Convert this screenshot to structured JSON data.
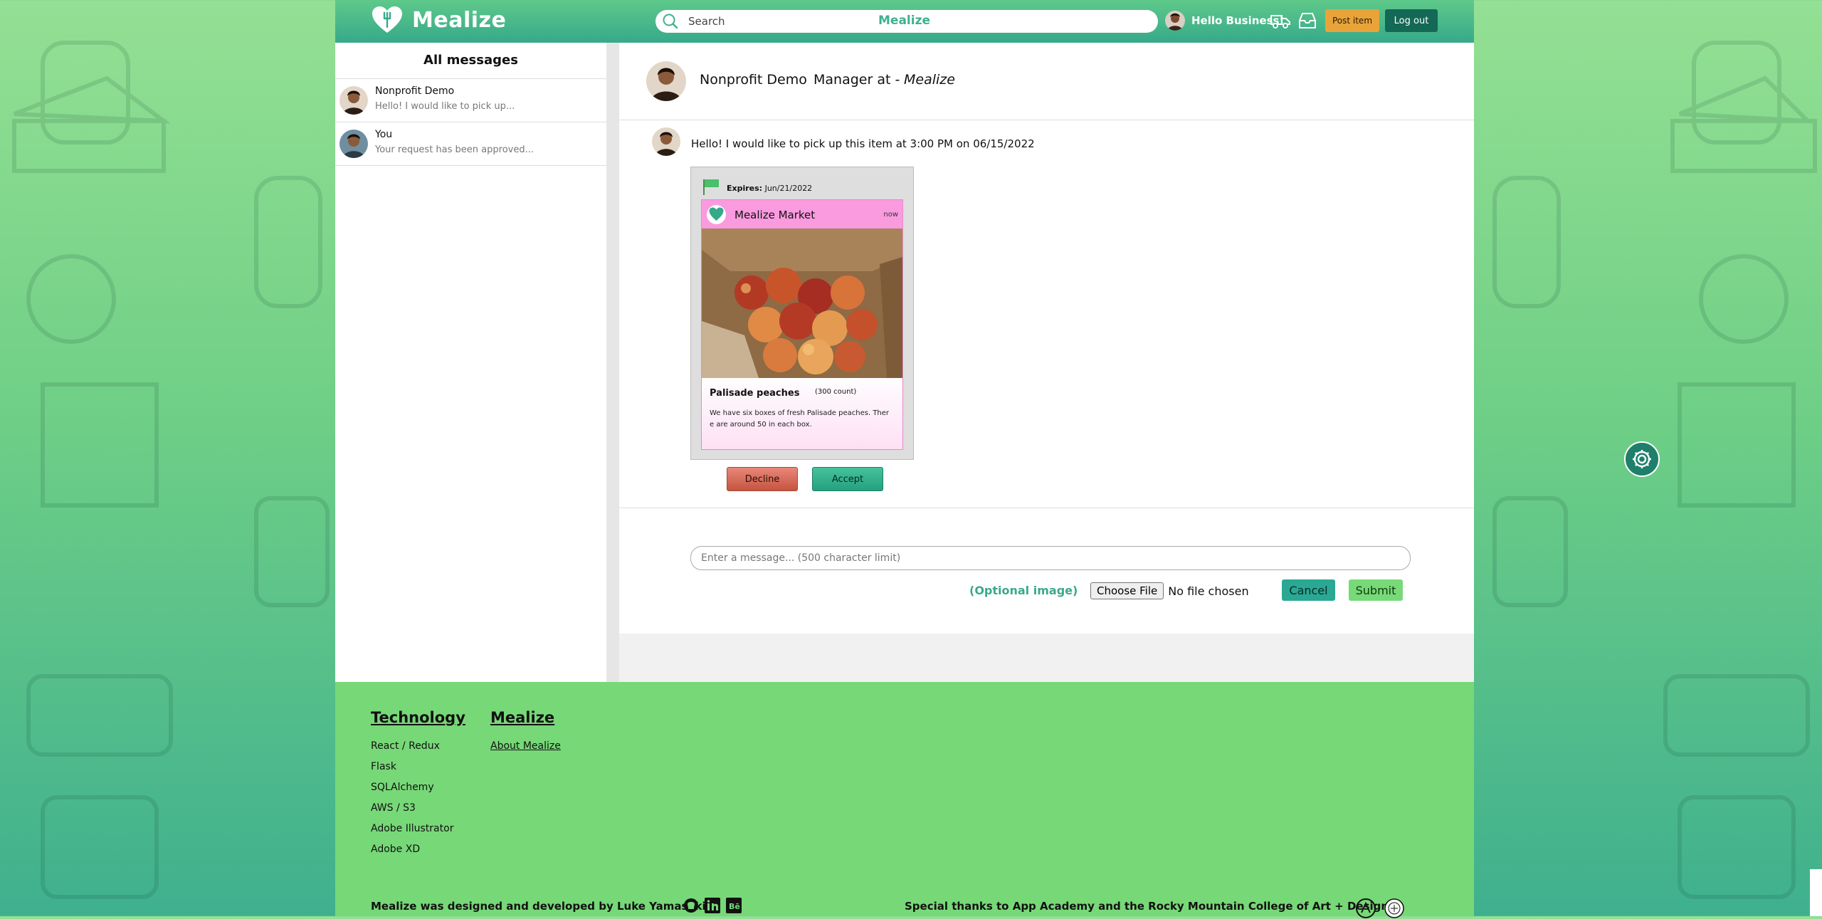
{
  "brand": "Mealize",
  "header": {
    "search_placeholder": "Search",
    "search_brand": "Mealize",
    "greeting": "Hello Business!",
    "post_item": "Post item",
    "log_out": "Log out"
  },
  "sidebar": {
    "title": "All messages",
    "threads": [
      {
        "name": "Nonprofit Demo",
        "preview": "Hello! I would like to pick up..."
      },
      {
        "name": "You",
        "preview": "Your request has been approved..."
      }
    ]
  },
  "chat": {
    "contact_name": "Nonprofit Demo",
    "contact_role": "Manager at -",
    "contact_company": "Mealize",
    "message": "Hello! I would like to pick up this item at 3:00 PM on 06/15/2022",
    "item": {
      "expires_label": "Expires:",
      "expires_date": "Jun/21/2022",
      "market": "Mealize Market",
      "time": "now",
      "name": "Palisade peaches",
      "count": "(300 count)",
      "description": "We have six boxes of fresh Palisade peaches. There are around 50 in each box."
    },
    "decline": "Decline",
    "accept": "Accept"
  },
  "compose": {
    "placeholder": "Enter a message... (500 character limit)",
    "optional_image": "(Optional image)",
    "choose_file": "Choose File",
    "no_file": "No file chosen",
    "cancel": "Cancel",
    "submit": "Submit"
  },
  "footer": {
    "technology_title": "Technology",
    "technology_items": [
      "React / Redux",
      "Flask",
      "SQLAlchemy",
      "AWS / S3",
      "Adobe Illustrator",
      "Adobe XD"
    ],
    "mealize_title": "Mealize",
    "about_link": "About Mealize",
    "credit": "Mealize was designed and developed by Luke Yamasaki",
    "thanks": "Special thanks to App Academy and the Rocky Mountain College of Art + Design"
  },
  "colors": {
    "header": "#36a98a",
    "post_item": "#e8a43a",
    "log_out": "#136856",
    "card_header": "#fa9adf",
    "footer": "#77d877"
  },
  "icons": [
    "heart-fork-logo-icon",
    "search-icon",
    "truck-icon",
    "inbox-icon",
    "flag-icon",
    "github-icon",
    "linkedin-icon",
    "behance-icon",
    "settings-gear-icon"
  ]
}
